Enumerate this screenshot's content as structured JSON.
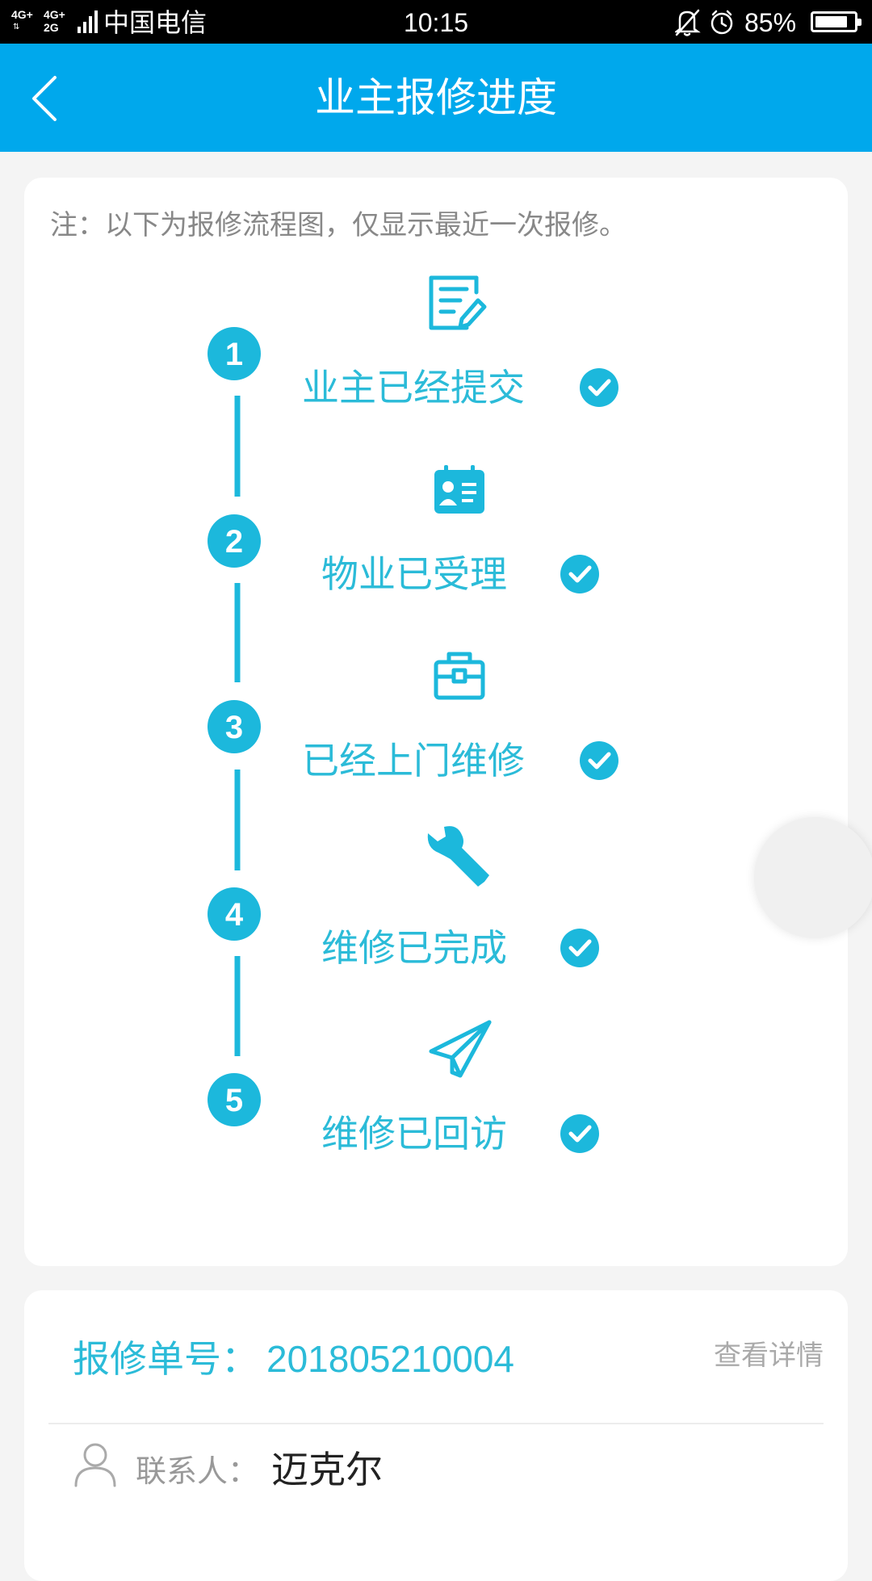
{
  "status_bar": {
    "network_1": "4G+",
    "network_2": "4G+",
    "network_3": "2G",
    "carrier": "中国电信",
    "time": "10:15",
    "battery_percent": "85%",
    "battery_level": 0.85
  },
  "header": {
    "title": "业主报修进度"
  },
  "progress": {
    "note": "注：以下为报修流程图，仅显示最近一次报修。",
    "accent_color": "#1cb8dc",
    "steps": [
      {
        "number": "1",
        "label": "业主已经提交",
        "icon": "edit-document-icon",
        "done": true
      },
      {
        "number": "2",
        "label": "物业已受理",
        "icon": "id-card-icon",
        "done": true
      },
      {
        "number": "3",
        "label": "已经上门维修",
        "icon": "toolbox-icon",
        "done": true
      },
      {
        "number": "4",
        "label": "维修已完成",
        "icon": "wrench-icon",
        "done": true
      },
      {
        "number": "5",
        "label": "维修已回访",
        "icon": "paper-plane-icon",
        "done": true
      }
    ]
  },
  "order": {
    "label": "报修单号：",
    "number": "201805210004",
    "view_detail": "查看详情",
    "contact_label": "联系人：",
    "contact_name": "迈克尔"
  },
  "colors": {
    "header_bg": "#00a8ec",
    "accent": "#2bbbd8",
    "background": "#f4f4f4"
  }
}
